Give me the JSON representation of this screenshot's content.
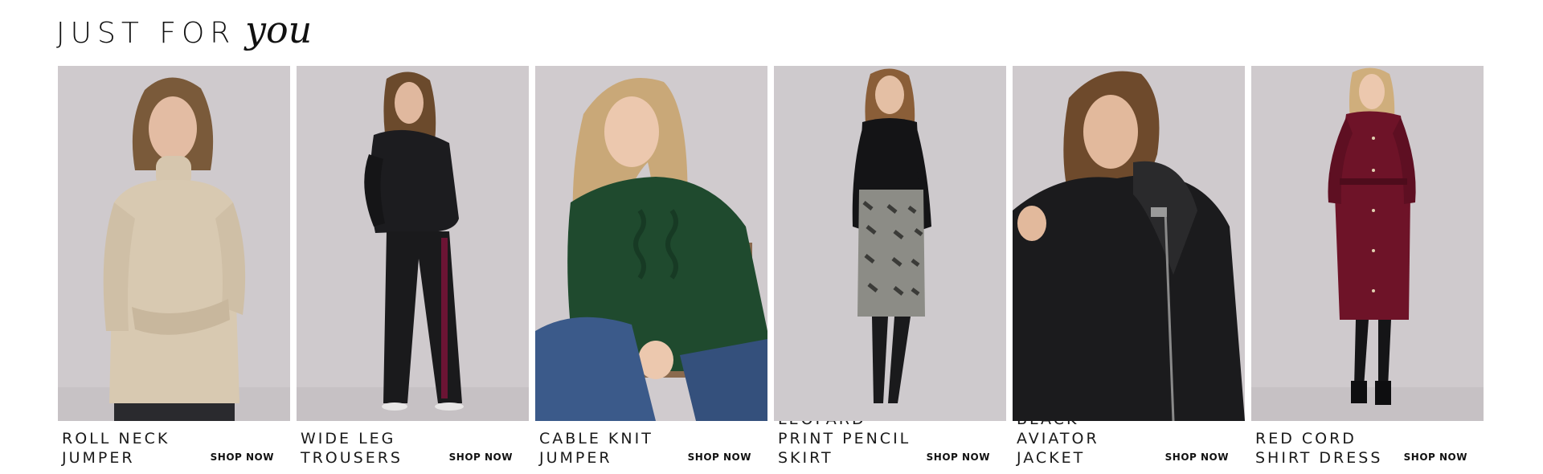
{
  "section": {
    "title_main": "JUST FOR",
    "title_accent": "you"
  },
  "products": [
    {
      "name": "ROLL NECK JUMPER",
      "cta": "SHOP NOW"
    },
    {
      "name": "WIDE LEG TROUSERS",
      "cta": "SHOP NOW"
    },
    {
      "name": "CABLE KNIT JUMPER",
      "cta": "SHOP NOW"
    },
    {
      "name": "LEOPARD PRINT PENCIL SKIRT",
      "cta": "SHOP NOW"
    },
    {
      "name": "BLACK AVIATOR JACKET",
      "cta": "SHOP NOW"
    },
    {
      "name": "RED CORD SHIRT DRESS",
      "cta": "SHOP NOW"
    }
  ],
  "colors": {
    "background": "#ffffff",
    "text": "#111111",
    "image_backdrop": "#cdc8cc"
  }
}
